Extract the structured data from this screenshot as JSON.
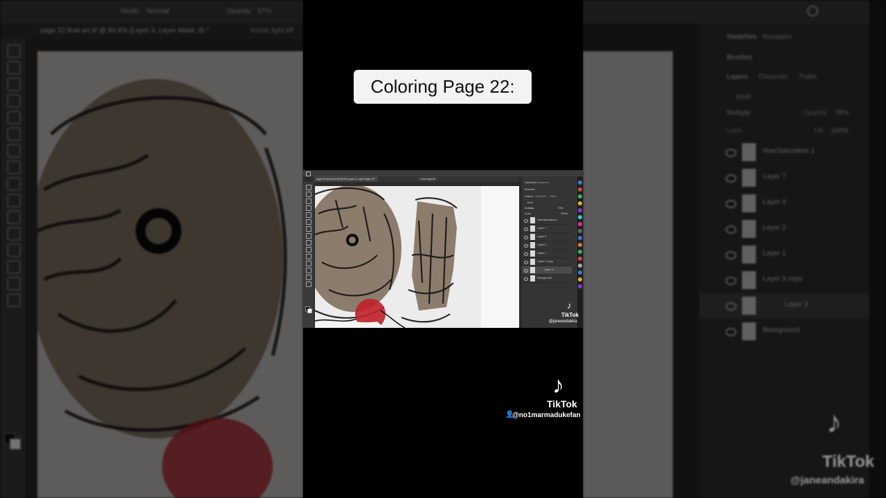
{
  "caption": {
    "text": "Coloring Page 22:"
  },
  "photoshop": {
    "doc_tab": "page 22 final art.tif @ 83.8% (Layer 3, Layer Mask, 8) *",
    "doc_tab_2": "horsie light.tiff",
    "options": {
      "mode_label": "Mode:",
      "mode_value": "Normal",
      "opacity_label": "Opacity:",
      "opacity_value": "57%"
    },
    "panel_tabs": [
      "Swatches",
      "Navigator",
      "Brushes"
    ],
    "layer_tabs": [
      "Layers",
      "Channels",
      "Paths"
    ],
    "kind_label": "Kind",
    "blend_mode": "Multiply",
    "layer_opacity_label": "Opacity:",
    "layer_opacity": "78%",
    "lock_label": "Lock:",
    "fill_label": "Fill:",
    "fill_value": "100%",
    "layers": [
      {
        "name": "Hue/Saturation 1"
      },
      {
        "name": "Layer 7"
      },
      {
        "name": "Layer 4"
      },
      {
        "name": "Layer 2"
      },
      {
        "name": "Layer 1"
      },
      {
        "name": "Layer 3 copy"
      },
      {
        "name": "Layer 3"
      },
      {
        "name": "Background"
      }
    ]
  },
  "inner_watermark": {
    "logo": "♪",
    "name": "TikTok",
    "user": "@janeandakira"
  },
  "main_watermark": {
    "logo": "♪",
    "name": "TikTok",
    "user": "@no1marmadukefan"
  },
  "right_watermark": {
    "logo": "♪",
    "name": "TikTok",
    "user": "@janeandakira"
  },
  "colors": {
    "caption_bg": "#f3f3f3",
    "paint_red": "#c0202a",
    "crayon_brown": "#8a7a6a"
  }
}
